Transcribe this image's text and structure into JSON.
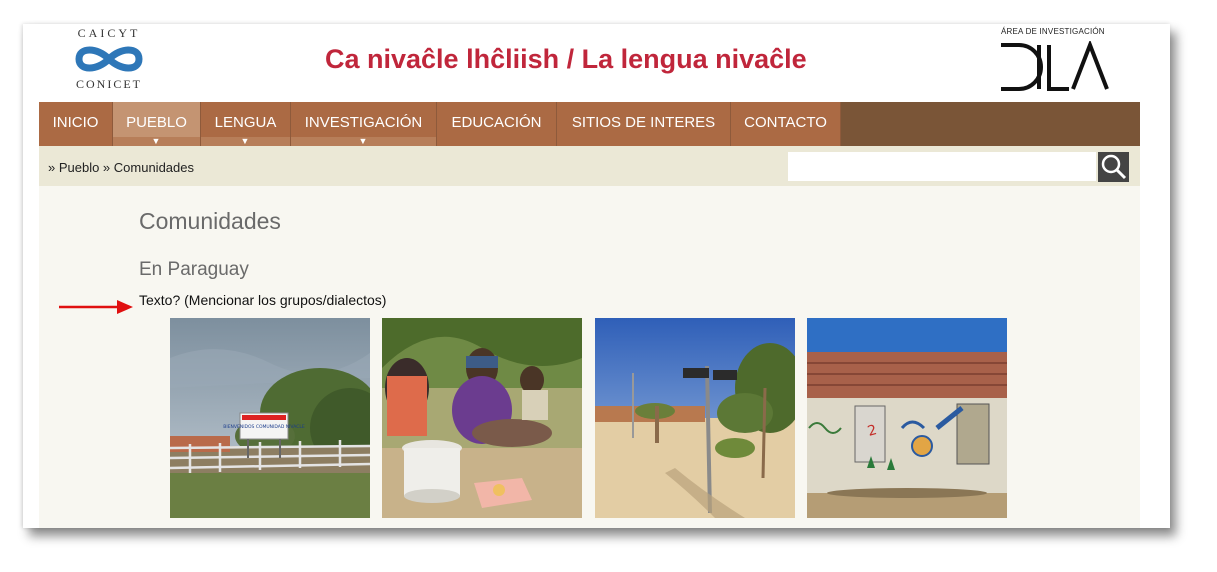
{
  "header": {
    "logo_left_top": "CAICYT",
    "logo_left_bottom": "CONICET",
    "site_title": "Ca nivaĉle lhĉliish / La lengua nivaĉle",
    "logo_right_caption": "ÁREA DE INVESTIGACIÓN",
    "logo_right_text": "DILA"
  },
  "nav": {
    "items": [
      {
        "label": "INICIO"
      },
      {
        "label": "PUEBLO"
      },
      {
        "label": "LENGUA"
      },
      {
        "label": "INVESTIGACIÓN"
      },
      {
        "label": "EDUCACIÓN"
      },
      {
        "label": "SITIOS DE INTERES"
      },
      {
        "label": "CONTACTO"
      }
    ],
    "dropdown_glyph": "▼"
  },
  "breadcrumb": "» Pueblo » Comunidades",
  "search": {
    "placeholder": "",
    "icon": "search-icon"
  },
  "main": {
    "title": "Comunidades",
    "subtitle": "En Paraguay",
    "note": "Texto? (Mencionar los grupos/dialectos)",
    "sign_text": "BIENVENIDOS COMUNIDAD NIVACLE",
    "photos": [
      {
        "name": "community-entrance-sign"
      },
      {
        "name": "women-seated-on-ground"
      },
      {
        "name": "street-sign-post"
      },
      {
        "name": "painted-house-wall"
      }
    ]
  },
  "colors": {
    "title_red": "#c0263b",
    "nav_bg": "#7a5537",
    "nav_item": "#ab6a44",
    "nav_active": "#c49472",
    "crumb_bg": "#ebe8d6",
    "content_bg": "#f8f7f1",
    "annotation_arrow": "#e01010"
  }
}
